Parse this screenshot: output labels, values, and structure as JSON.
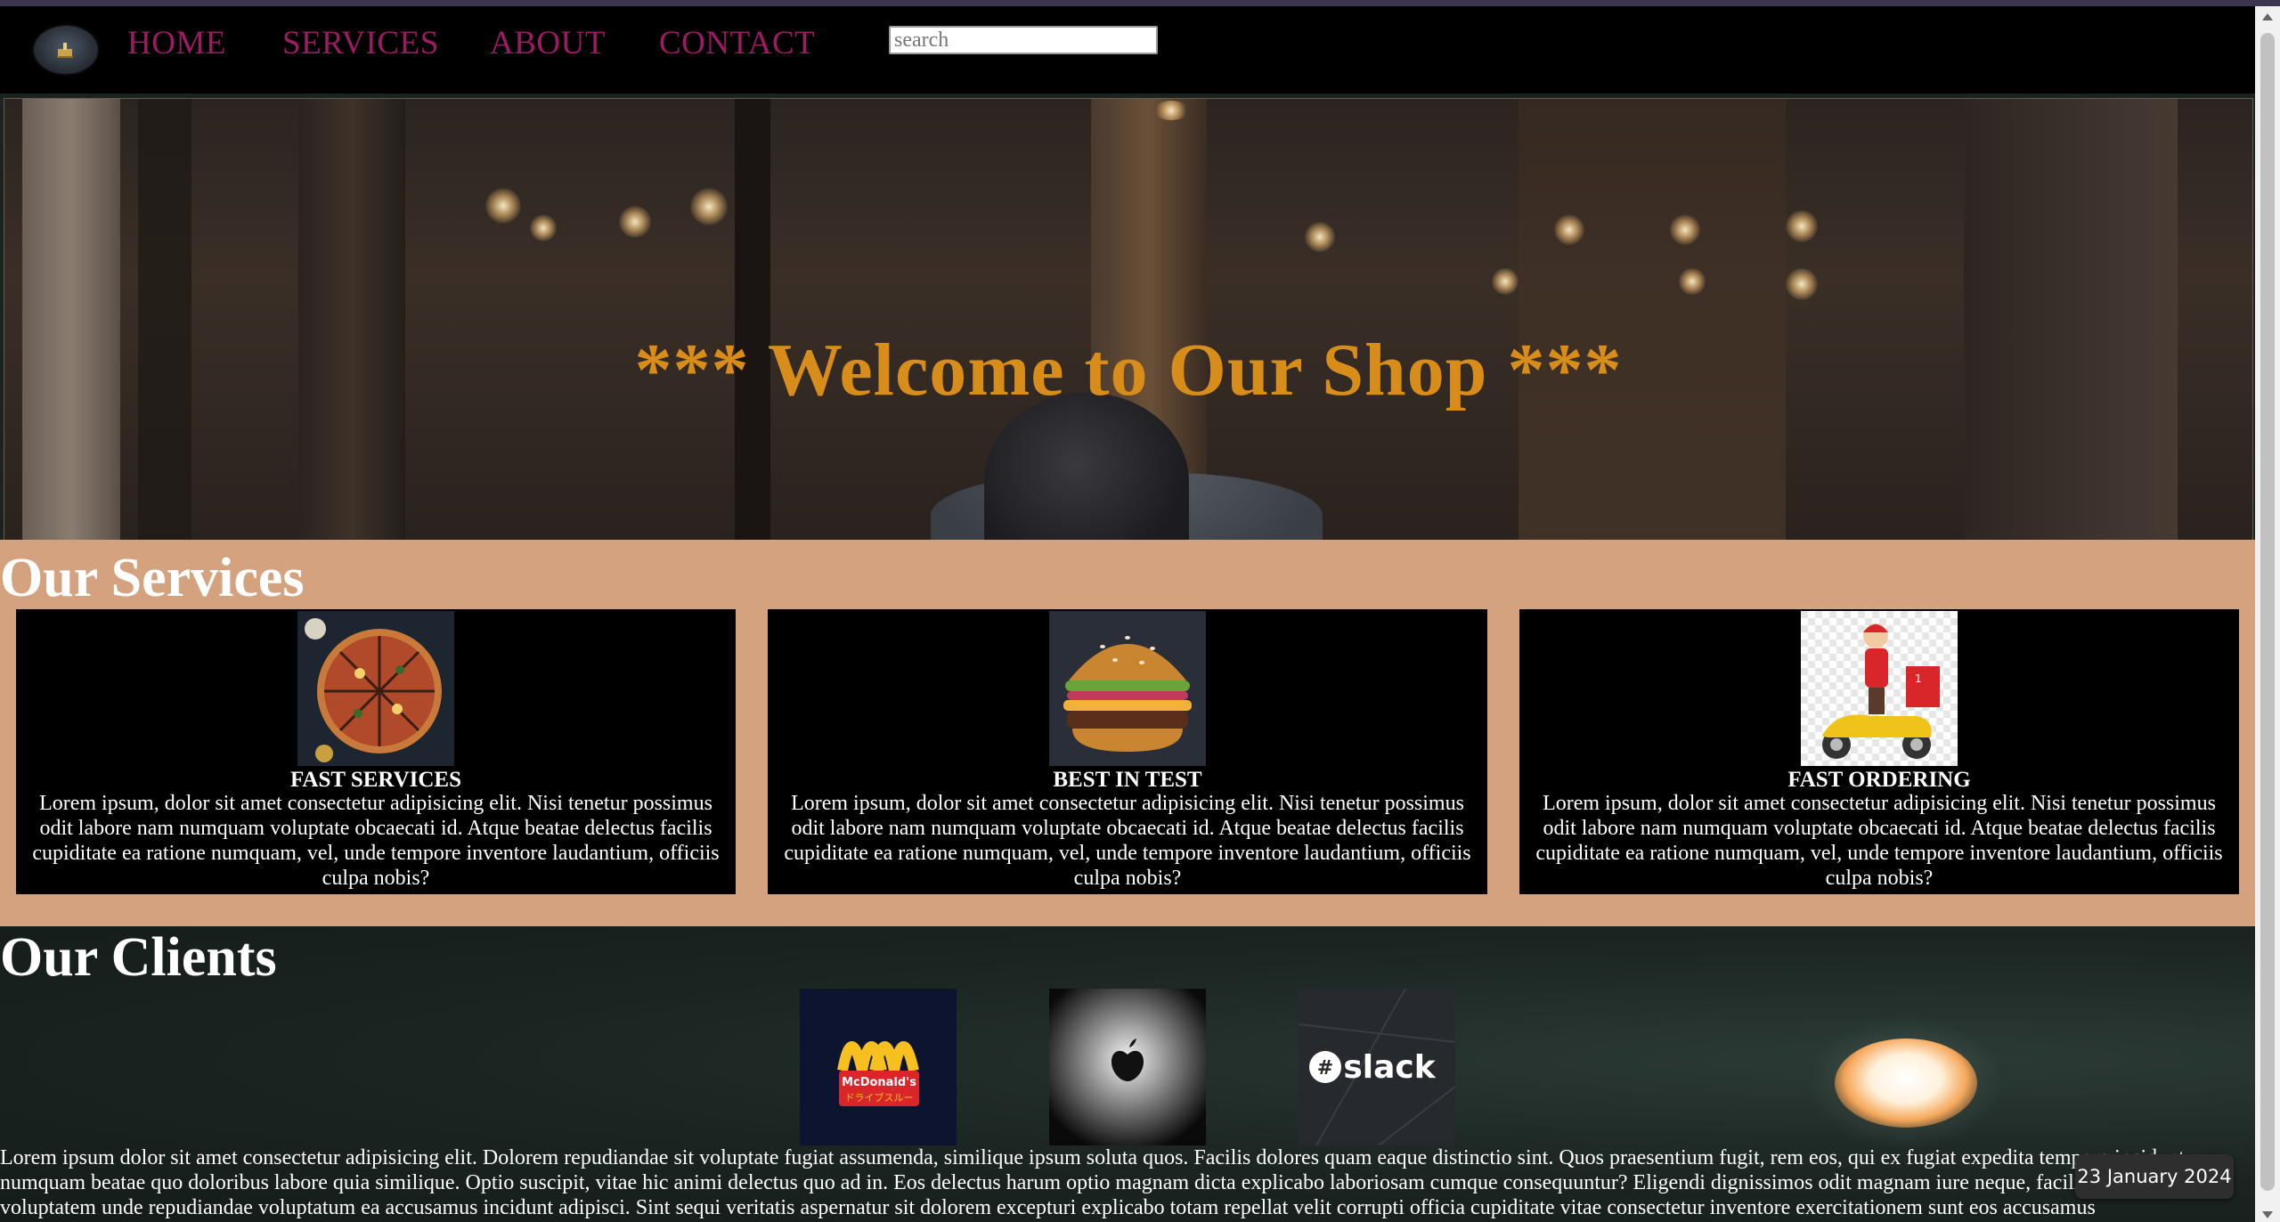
{
  "nav": {
    "links": [
      "HOME",
      "SERVICES",
      "ABOUT",
      "CONTACT"
    ],
    "search_placeholder": "search",
    "link_color": "#9c1b62"
  },
  "hero": {
    "title": "*** Welcome to Our Shop ***",
    "title_color": "#d88d1a"
  },
  "services": {
    "heading": "Our Services",
    "background": "#d4a27f",
    "cards": [
      {
        "image": "pizza",
        "title": "FAST SERVICES",
        "text": "Lorem ipsum, dolor sit amet consectetur adipisicing elit. Nisi tenetur possimus odit labore nam numquam voluptate obcaecati id. Atque beatae delectus facilis cupiditate ea ratione numquam, vel, unde tempore inventore laudantium, officiis culpa nobis?"
      },
      {
        "image": "burger",
        "title": "BEST IN TEST",
        "text": "Lorem ipsum, dolor sit amet consectetur adipisicing elit. Nisi tenetur possimus odit labore nam numquam voluptate obcaecati id. Atque beatae delectus facilis cupiditate ea ratione numquam, vel, unde tempore inventore laudantium, officiis culpa nobis?"
      },
      {
        "image": "delivery-scooter",
        "title": "FAST ORDERING",
        "text": "Lorem ipsum, dolor sit amet consectetur adipisicing elit. Nisi tenetur possimus odit labore nam numquam voluptate obcaecati id. Atque beatae delectus facilis cupiditate ea ratione numquam, vel, unde tempore inventore laudantium, officiis culpa nobis?"
      }
    ]
  },
  "clients": {
    "heading": "Our Clients",
    "logos": [
      {
        "name": "mcdonalds",
        "text": "McDonald's",
        "subtext": "ドライブスルー"
      },
      {
        "name": "apple"
      },
      {
        "name": "slack",
        "text": "slack"
      }
    ],
    "paragraph": "Lorem ipsum dolor sit amet consectetur adipisicing elit. Dolorem repudiandae sit voluptate fugiat assumenda, similique ipsum soluta quos. Facilis dolores quam eaque distinctio sint. Quos praesentium fugit, rem eos, qui ex fugiat expedita tempora incidunt numquam beatae quo doloribus labore quia similique. Optio suscipit, vitae hic animi delectus quo ad in. Eos delectus harum optio magnam dicta explicabo laboriosam cumque consequuntur? Eligendi dignissimos odit magnam iure neque, facilis architecto voluptatem unde repudiandae voluptatum ea accusamus incidunt adipisci. Sint sequi veritatis aspernatur sit dolorem excepturi explicabo totam repellat velit corrupti officia cupiditate vitae consectetur inventore exercitationem sunt eos accusamus"
  },
  "taskbar": {
    "date": "23 January 2024"
  }
}
